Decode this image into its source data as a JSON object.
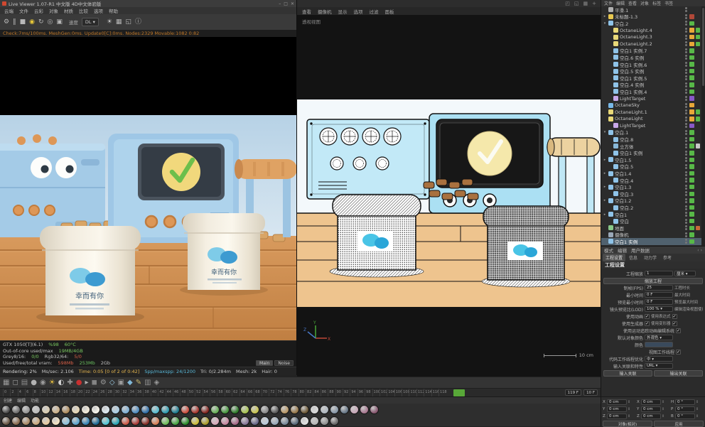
{
  "colors": {
    "accent_orange": "#d08a3a",
    "machine_blue": "#a4cbe7",
    "toon_cyan": "#bfe9f7",
    "check_green": "#6dbf4b",
    "logo_blue": "#3d9bd1",
    "playhead_green": "#58a838"
  },
  "octane": {
    "title": "Live Viewer 1.07-R1 中文版 4D中文体验版",
    "window_buttons": [
      "–",
      "□",
      "✕"
    ],
    "menus": [
      "云端",
      "文件",
      "云彩",
      "对象",
      "材质",
      "比较",
      "选项",
      "帮助"
    ],
    "toolbar": {
      "left_icons": [
        {
          "g": "⚙",
          "c": "#b8b8b8"
        },
        {
          "g": "‖",
          "c": "#b8b8b8"
        },
        {
          "g": "■",
          "c": "#b8b8b8"
        },
        {
          "g": "◉",
          "c": "#e8c838"
        },
        {
          "g": "↻",
          "c": "#b8b8b8"
        },
        {
          "g": "◎",
          "c": "#b8b8b8"
        },
        {
          "g": "▣",
          "c": "#b8b8b8"
        }
      ],
      "speed_label": "速度",
      "speed_value": "DL ▾",
      "right_icons": [
        {
          "g": "☀",
          "c": "#c8c8c8"
        },
        {
          "g": "▦",
          "c": "#b8b8b8"
        },
        {
          "g": "◱",
          "c": "#b8b8b8"
        },
        {
          "g": "ⓘ",
          "c": "#b8b8b8"
        }
      ]
    },
    "status_line": "Check:7ms/100ms. MeshGen:0ms. Update0[C]:0ms. Nodes:2329 Movable:1082 0:82",
    "footer": {
      "gpu": "GTX 1050[T](6.1)",
      "gpu_load": "%98",
      "gpu_temp": "60°C",
      "oc_label": "Out-of-core used/max",
      "oc_value": "19MB/4GB",
      "mem_parts": [
        {
          "t": "Grey8/16:",
          "c": "#c0c0c0"
        },
        {
          "t": "0/0",
          "c": "#7ac860"
        },
        {
          "t": "Rgb32/64:",
          "c": "#c0c0c0"
        },
        {
          "t": "5/0",
          "c": "#d86048"
        }
      ],
      "vram_label": "Used/free/total vram:",
      "vram_used": "598Mb",
      "vram_free": "253Mb",
      "vram_total": "2Gb",
      "tabs": [
        {
          "t": "Main",
          "cls": "active"
        },
        {
          "t": "Noise",
          "cls": ""
        }
      ],
      "stats": [
        {
          "t": "Rendering: 2%",
          "c": "#d8d8d8"
        },
        {
          "t": "Ms/sec: 2.106",
          "c": "#c8c8c8"
        },
        {
          "t": "Time: 0:05 [0 of 2 of 0:42]",
          "c": "#e8b850"
        },
        {
          "t": "Spp/maxspp: 24/1200",
          "c": "#58b8d8"
        },
        {
          "t": "Tri: 0/2.284m",
          "c": "#c8c8c8"
        },
        {
          "t": "Mesh: 2k",
          "c": "#c8c8c8"
        },
        {
          "t": "Hair: 0",
          "c": "#c8c8c8"
        }
      ]
    },
    "scene": {
      "jar_text": "幸而有你"
    }
  },
  "viewport": {
    "menus": [
      "查看",
      "摄像机",
      "显示",
      "选项",
      "过滤",
      "面板"
    ],
    "top_icons": [
      {
        "g": "◰",
        "c": "#8a8a8a"
      },
      {
        "g": "◱",
        "c": "#8a8a8a"
      },
      {
        "g": "▦",
        "c": "#8a8a8a"
      },
      {
        "g": "+",
        "c": "#8a8a8a"
      }
    ],
    "label": "透视视图",
    "scale_label": "10 cm",
    "axis_x": "X",
    "axis_y": "Y",
    "axis_z": "Z"
  },
  "object_manager": {
    "menus": [
      "文件",
      "编辑",
      "查看",
      "对象",
      "标签",
      "书签"
    ],
    "items": [
      {
        "n": "平滑.1",
        "ic": "#b0b0b0",
        "pad": "2px",
        "ar": "",
        "t1": "",
        "t2": ""
      },
      {
        "n": "未标题-1.3",
        "ic": "#e8c850",
        "pad": "2px",
        "ar": "▸",
        "t1": "#b04838",
        "t2": ""
      },
      {
        "n": "空白.2",
        "ic": "#8fc3e8",
        "pad": "2px",
        "ar": "▾",
        "t1": "#58b848",
        "t2": ""
      },
      {
        "n": "OctaneLight.4",
        "ic": "#e8d878",
        "pad": "9px",
        "ar": "",
        "t1": "#e8a838",
        "t2": "#58b848"
      },
      {
        "n": "OctaneLight.3",
        "ic": "#e8d878",
        "pad": "9px",
        "ar": "",
        "t1": "#e8a838",
        "t2": "#58b848"
      },
      {
        "n": "OctaneLight.2",
        "ic": "#e8d878",
        "pad": "9px",
        "ar": "",
        "t1": "#e8a838",
        "t2": "#58b848"
      },
      {
        "n": "空白1 实例.7",
        "ic": "#8fc3e8",
        "pad": "9px",
        "ar": "",
        "t1": "#58b848",
        "t2": ""
      },
      {
        "n": "空白.6 实例",
        "ic": "#8fc3e8",
        "pad": "9px",
        "ar": "",
        "t1": "#58b848",
        "t2": ""
      },
      {
        "n": "空白1 实例.6",
        "ic": "#8fc3e8",
        "pad": "9px",
        "ar": "",
        "t1": "#58b848",
        "t2": ""
      },
      {
        "n": "空白.5 实例",
        "ic": "#8fc3e8",
        "pad": "9px",
        "ar": "",
        "t1": "#58b848",
        "t2": ""
      },
      {
        "n": "空白1 实例.5",
        "ic": "#8fc3e8",
        "pad": "9px",
        "ar": "",
        "t1": "#58b848",
        "t2": ""
      },
      {
        "n": "空白.4 实例",
        "ic": "#8fc3e8",
        "pad": "9px",
        "ar": "",
        "t1": "#58b848",
        "t2": ""
      },
      {
        "n": "空白1 实例.4",
        "ic": "#8fc3e8",
        "pad": "9px",
        "ar": "",
        "t1": "#58b848",
        "t2": ""
      },
      {
        "n": "LightTarget",
        "ic": "#c8a8e8",
        "pad": "9px",
        "ar": "",
        "t1": "#8858c8",
        "t2": ""
      },
      {
        "n": "OctaneSky",
        "ic": "#78b8e8",
        "pad": "2px",
        "ar": "",
        "t1": "#e8a838",
        "t2": ""
      },
      {
        "n": "OctaneLight.1",
        "ic": "#e8d878",
        "pad": "2px",
        "ar": "",
        "t1": "#e8a838",
        "t2": "#58b848"
      },
      {
        "n": "OctaneLight",
        "ic": "#e8d878",
        "pad": "2px",
        "ar": "",
        "t1": "#e8a838",
        "t2": "#58b848"
      },
      {
        "n": "LightTarget",
        "ic": "#c8a8e8",
        "pad": "9px",
        "ar": "",
        "t1": "#8858c8",
        "t2": ""
      },
      {
        "n": "空白.1",
        "ic": "#8fc3e8",
        "pad": "2px",
        "ar": "▾",
        "t1": "#58b848",
        "t2": ""
      },
      {
        "n": "空白.8",
        "ic": "#8fc3e8",
        "pad": "9px",
        "ar": "",
        "t1": "#58b848",
        "t2": ""
      },
      {
        "n": "立方体",
        "ic": "#88b8d8",
        "pad": "9px",
        "ar": "",
        "t1": "#58b848",
        "t2": "#c8c8c8"
      },
      {
        "n": "空白1 实例",
        "ic": "#8fc3e8",
        "pad": "9px",
        "ar": "",
        "t1": "#58b848",
        "t2": ""
      },
      {
        "n": "空白1.5",
        "ic": "#8fc3e8",
        "pad": "2px",
        "ar": "▸",
        "t1": "#58b848",
        "t2": ""
      },
      {
        "n": "空白.5",
        "ic": "#8fc3e8",
        "pad": "9px",
        "ar": "",
        "t1": "#58b848",
        "t2": ""
      },
      {
        "n": "空白1.4",
        "ic": "#8fc3e8",
        "pad": "2px",
        "ar": "▸",
        "t1": "#58b848",
        "t2": ""
      },
      {
        "n": "空白.4",
        "ic": "#8fc3e8",
        "pad": "9px",
        "ar": "",
        "t1": "#58b848",
        "t2": ""
      },
      {
        "n": "空白1.3",
        "ic": "#8fc3e8",
        "pad": "2px",
        "ar": "▸",
        "t1": "#58b848",
        "t2": ""
      },
      {
        "n": "空白.3",
        "ic": "#8fc3e8",
        "pad": "9px",
        "ar": "",
        "t1": "#58b848",
        "t2": ""
      },
      {
        "n": "空白1.2",
        "ic": "#8fc3e8",
        "pad": "2px",
        "ar": "▸",
        "t1": "#58b848",
        "t2": ""
      },
      {
        "n": "空白.2",
        "ic": "#8fc3e8",
        "pad": "9px",
        "ar": "",
        "t1": "#58b848",
        "t2": ""
      },
      {
        "n": "空白1",
        "ic": "#8fc3e8",
        "pad": "2px",
        "ar": "▸",
        "t1": "#58b848",
        "t2": ""
      },
      {
        "n": "空白",
        "ic": "#8fc3e8",
        "pad": "9px",
        "ar": "",
        "t1": "#58b848",
        "t2": ""
      },
      {
        "n": "地面",
        "ic": "#88c888",
        "pad": "2px",
        "ar": "",
        "t1": "#58b848",
        "t2": "#c86838"
      },
      {
        "n": "摄像机",
        "ic": "#9aa8b8",
        "pad": "2px",
        "ar": "",
        "t1": "#58b848",
        "t2": ""
      },
      {
        "n": "空白1 实例",
        "ic": "#8fc3e8",
        "pad": "2px",
        "ar": "",
        "t1": "#58b848",
        "t2": "",
        "sel": "sel"
      }
    ]
  },
  "attributes": {
    "mode_tabs": [
      "模式",
      "编辑",
      "用户数据"
    ],
    "mode_extra": "‹ ›",
    "filter_tabs": [
      {
        "t": "工程设置",
        "cls": "active"
      },
      {
        "t": "信息",
        "cls": ""
      },
      {
        "t": "动力学",
        "cls": ""
      },
      {
        "t": "参考",
        "cls": ""
      }
    ],
    "section": "工程设置",
    "rows": [
      {
        "t": "iosel",
        "l": "工程缩放",
        "v": "1",
        "v2": "厘米 ▾"
      },
      {
        "t": "btn",
        "l": "",
        "v": "缩放工程"
      },
      {
        "t": "io2",
        "l": "制帧(FPS)",
        "v": "25",
        "l2": "工程时长"
      },
      {
        "t": "io2",
        "l": "最小时间",
        "v": "0 F",
        "l2": "最大时间"
      },
      {
        "t": "io2",
        "l": "预览最小时间",
        "v": "0 F",
        "l2": "预览最大时间"
      },
      {
        "t": "io2",
        "l": "镜头预览比(LOD)",
        "v": "100 % ▾",
        "l2": "编辑渲染视图使用预览比"
      },
      {
        "t": "ck2",
        "l": "使用动画",
        "l2": "使用表达式"
      },
      {
        "t": "ck2",
        "l": "使用生成器",
        "l2": "使用变形器"
      },
      {
        "t": "ck1",
        "l": "使用运动追踪动画编辑系统"
      },
      {
        "t": "io",
        "l": "默认对象颜色",
        "v": "外观色 ▾"
      },
      {
        "t": "color",
        "l": "颜色"
      },
      {
        "t": "ck1",
        "l": "视图工作线程"
      },
      {
        "t": "io",
        "l": "代码工作线程优化",
        "v": "中 ▾"
      },
      {
        "t": "io",
        "l": "输入关联和特性",
        "v": "URL ▾"
      },
      {
        "t": "btn2",
        "l": "",
        "v": "输入关联",
        "v2": "输出关联"
      }
    ]
  },
  "anim_toolbar": {
    "icons": [
      {
        "g": "▦",
        "c": "#9a9a9a"
      },
      {
        "g": "◻",
        "c": "#9a9a9a"
      },
      {
        "g": "▤",
        "c": "#8e8e8e"
      },
      {
        "g": "●",
        "c": "#b2b2b2"
      },
      {
        "g": "◉",
        "c": "#9a9a9a"
      },
      {
        "g": "☀",
        "c": "#e8c040"
      },
      {
        "g": "◐",
        "c": "#d0d0d0"
      },
      {
        "g": "✚",
        "c": "#9a9a9a"
      },
      {
        "g": "●",
        "c": "#c83030"
      },
      {
        "g": "▸",
        "c": "#b0b0b0"
      },
      {
        "g": "◼",
        "c": "#848484"
      },
      {
        "g": "⚙",
        "c": "#9a9a9a"
      },
      {
        "g": "◇",
        "c": "#9ac8e0"
      },
      {
        "g": "▣",
        "c": "#9a9a9a"
      },
      {
        "g": "◆",
        "c": "#80b8d8"
      },
      {
        "g": "✎",
        "c": "#c8b870"
      },
      {
        "g": "▥",
        "c": "#8e8e8e"
      },
      {
        "g": "◈",
        "c": "#9a9a9a"
      }
    ]
  },
  "timeline": {
    "ticks": [
      "0",
      "2",
      "4",
      "6",
      "8",
      "10",
      "12",
      "14",
      "16",
      "18",
      "20",
      "22",
      "24",
      "26",
      "28",
      "30",
      "32",
      "34",
      "36",
      "38",
      "40",
      "42",
      "44",
      "46",
      "48",
      "50",
      "52",
      "54",
      "56",
      "58",
      "60",
      "62",
      "64",
      "66",
      "68",
      "70",
      "72",
      "74",
      "76",
      "78",
      "80",
      "82",
      "84",
      "86",
      "88",
      "90",
      "92",
      "94",
      "96",
      "98",
      "100",
      "102",
      "104",
      "106",
      "108",
      "110",
      "112",
      "114",
      "116",
      "118"
    ],
    "end_field": "119 F",
    "current_field": "10 F"
  },
  "materials": {
    "menus": [
      "创建",
      "编辑",
      "功能"
    ],
    "row1": [
      "#4a4a4a",
      "#6e6e6e",
      "#969696",
      "#bcbcbc",
      "#d8cbb0",
      "#cbb089",
      "#b08d5e",
      "#e6d6b4",
      "#f2ead8",
      "#f8f4ea",
      "#dce8f0",
      "#aacde4",
      "#7fb0d6",
      "#4f8cc0",
      "#2f6ea8",
      "#58bcd0",
      "#2f9cb0",
      "#1f7c90",
      "#cc5040",
      "#a83830",
      "#852822",
      "#68b058",
      "#48983f",
      "#2f7c2a",
      "#a8c452",
      "#c8c452",
      "#8a8a8a",
      "#5a5a5a",
      "#b89868",
      "#97794c",
      "#6e5a38",
      "#d8d8d8",
      "#b0b8c0",
      "#8898a8",
      "#687888",
      "#c8a8b8",
      "#a87890",
      "#885870"
    ],
    "row2": [
      "#6a5846",
      "#8a6c50",
      "#aa8a66",
      "#caa87e",
      "#e6c9a0",
      "#f2e2c2",
      "#8cc0da",
      "#5ca4cc",
      "#3684b4",
      "#1e6a94",
      "#52c4d4",
      "#2aa4b4",
      "#cc5a48",
      "#aa3c38",
      "#883028",
      "#d88058",
      "#70bc5a",
      "#4aa444",
      "#2e8c2c",
      "#ccbc3c",
      "#aa9c2c",
      "#d8aaba",
      "#c88aa2",
      "#a86c8a",
      "#8a7a9a",
      "#6a6a8a",
      "#bacada",
      "#9aaaba",
      "#7a8a9a",
      "#5a6a7a",
      "#e0e0e0",
      "#b8b8b8",
      "#909090",
      "#686868"
    ]
  },
  "coordinates": {
    "cells": [
      {
        "l": "X",
        "v": "0 cm"
      },
      {
        "l": "Y",
        "v": "0 cm"
      },
      {
        "l": "Z",
        "v": "0 cm"
      },
      {
        "l": "X",
        "v": "0 cm"
      },
      {
        "l": "Y",
        "v": "0 cm"
      },
      {
        "l": "Z",
        "v": "0 cm"
      },
      {
        "l": "H",
        "v": "0 °"
      },
      {
        "l": "P",
        "v": "0 °"
      },
      {
        "l": "B",
        "v": "0 °"
      }
    ],
    "footer": [
      "对象(相对)",
      "应用"
    ]
  }
}
